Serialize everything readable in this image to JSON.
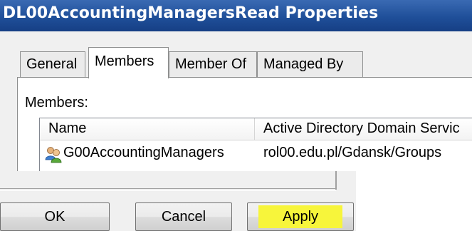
{
  "window": {
    "title": "DL00AccountingManagersRead Properties"
  },
  "tabs": [
    {
      "label": "General",
      "active": false
    },
    {
      "label": "Members",
      "active": true
    },
    {
      "label": "Member Of",
      "active": false
    },
    {
      "label": "Managed By",
      "active": false
    }
  ],
  "members_panel": {
    "label": "Members:",
    "columns": [
      "Name",
      "Active Directory Domain Servic"
    ],
    "rows": [
      {
        "icon": "group-icon",
        "name": "G00AccountingManagers",
        "folder": "rol00.edu.pl/Gdansk/Groups"
      }
    ]
  },
  "buttons": {
    "ok": "OK",
    "cancel": "Cancel",
    "apply": "Apply"
  },
  "colors": {
    "titlebar": "#1f4f99",
    "apply_highlight": "#f7f53b"
  }
}
